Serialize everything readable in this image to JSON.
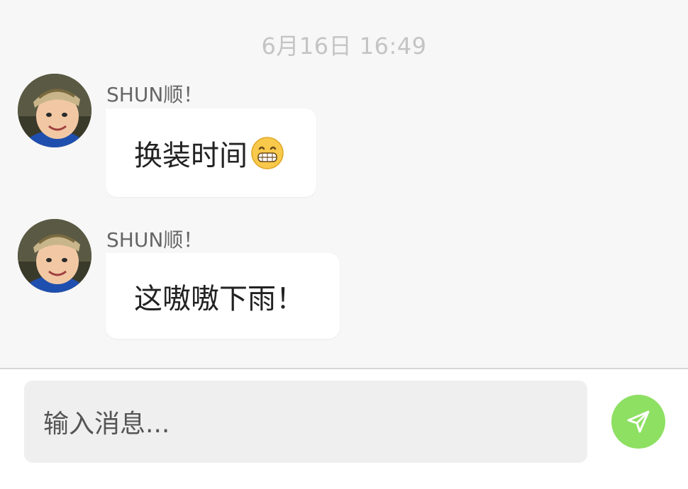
{
  "chat": {
    "timestamp": "6月16日 16:49",
    "messages": [
      {
        "sender": "SHUN顺！",
        "text": "换装时间",
        "emoji": "grinning-face-icon"
      },
      {
        "sender": "SHUN顺！",
        "text": "这嗷嗷下雨！"
      }
    ]
  },
  "composer": {
    "placeholder": "输入消息...",
    "send_icon": "send-icon"
  },
  "colors": {
    "background": "#f7f7f7",
    "bubble": "#ffffff",
    "send_button": "#8de062"
  }
}
